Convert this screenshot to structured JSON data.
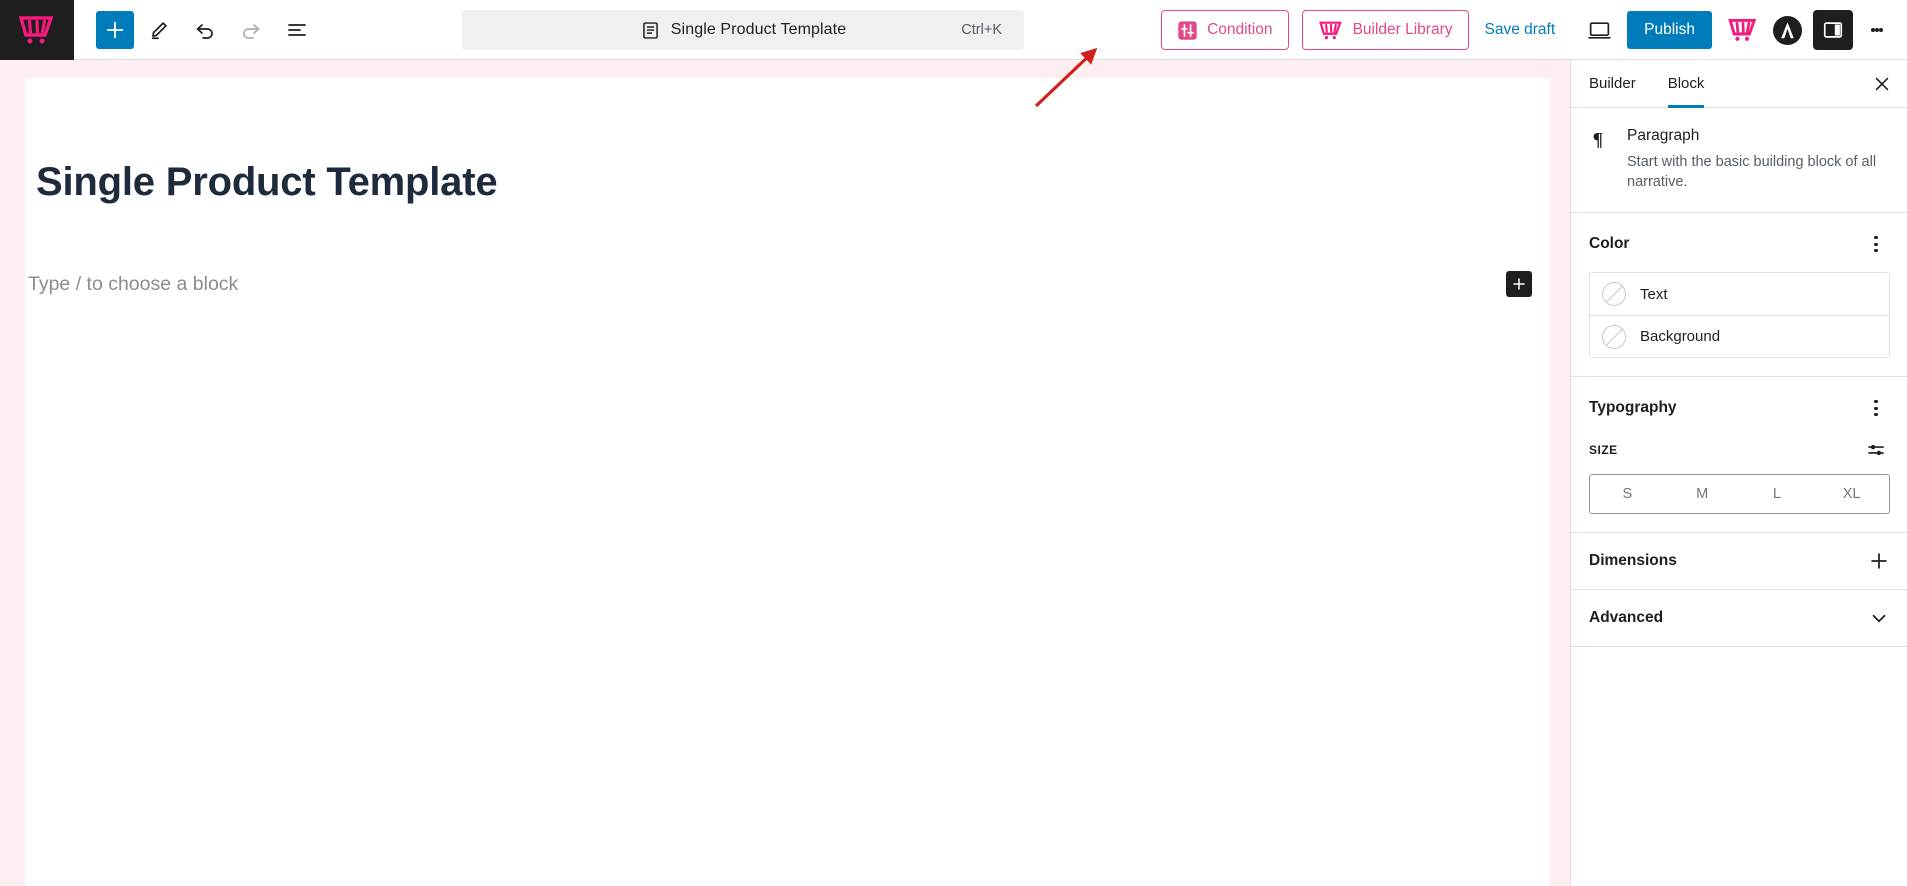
{
  "topbar": {
    "logo_icon": "woo-cart-logo",
    "tools": [
      {
        "name": "add-block-toggle",
        "icon": "plus-icon"
      },
      {
        "name": "tools-edit",
        "icon": "pencil-icon"
      },
      {
        "name": "undo",
        "icon": "undo-arrow-icon"
      },
      {
        "name": "redo",
        "icon": "redo-arrow-icon"
      },
      {
        "name": "list-view",
        "icon": "list-view-icon"
      }
    ],
    "document": {
      "icon": "template-document-icon",
      "title": "Single Product Template",
      "shortcut": "Ctrl+K"
    },
    "condition_button": {
      "label": "Condition",
      "icon": "sliders-icon"
    },
    "library_button": {
      "label": "Builder Library",
      "icon": "woo-cart-logo"
    },
    "save_draft": "Save draft",
    "preview_icon": "desktop-preview-icon",
    "publish_label": "Publish",
    "brand_logo_icon": "woo-cart-logo",
    "astra_logo_icon": "astra-a-logo",
    "settings_toggle_icon": "sidebar-panel-icon",
    "options_icon": "kebab-menu-icon",
    "accent_pink": "#e2498a",
    "accent_blue": "#007cba"
  },
  "canvas": {
    "post_title": "Single Product Template",
    "block_placeholder": "Type / to choose a block",
    "add_block_icon": "plus-icon",
    "title_color": "#1e2b3c",
    "frame_color": "#fdeef2"
  },
  "sidebar": {
    "tabs": [
      {
        "label": "Builder",
        "active": false
      },
      {
        "label": "Block",
        "active": true
      }
    ],
    "close_icon": "close-x-icon",
    "block_info": {
      "icon": "paragraph-pilcrow-icon",
      "title": "Paragraph",
      "description": "Start with the basic building block of all narrative."
    },
    "color_panel": {
      "title": "Color",
      "menu_icon": "kebab-menu-icon",
      "options": [
        {
          "label": "Text",
          "swatch": "none"
        },
        {
          "label": "Background",
          "swatch": "none"
        }
      ]
    },
    "typography_panel": {
      "title": "Typography",
      "menu_icon": "kebab-menu-icon",
      "size_label": "SIZE",
      "size_settings_icon": "size-sliders-icon",
      "sizes": [
        "S",
        "M",
        "L",
        "XL"
      ],
      "selected_size": null
    },
    "dimensions_panel": {
      "title": "Dimensions",
      "icon": "plus-icon"
    },
    "advanced_panel": {
      "title": "Advanced",
      "icon": "chevron-down-icon"
    }
  },
  "annotation": {
    "type": "arrow",
    "color": "#d0211c",
    "points_to": "builder-library-button"
  }
}
